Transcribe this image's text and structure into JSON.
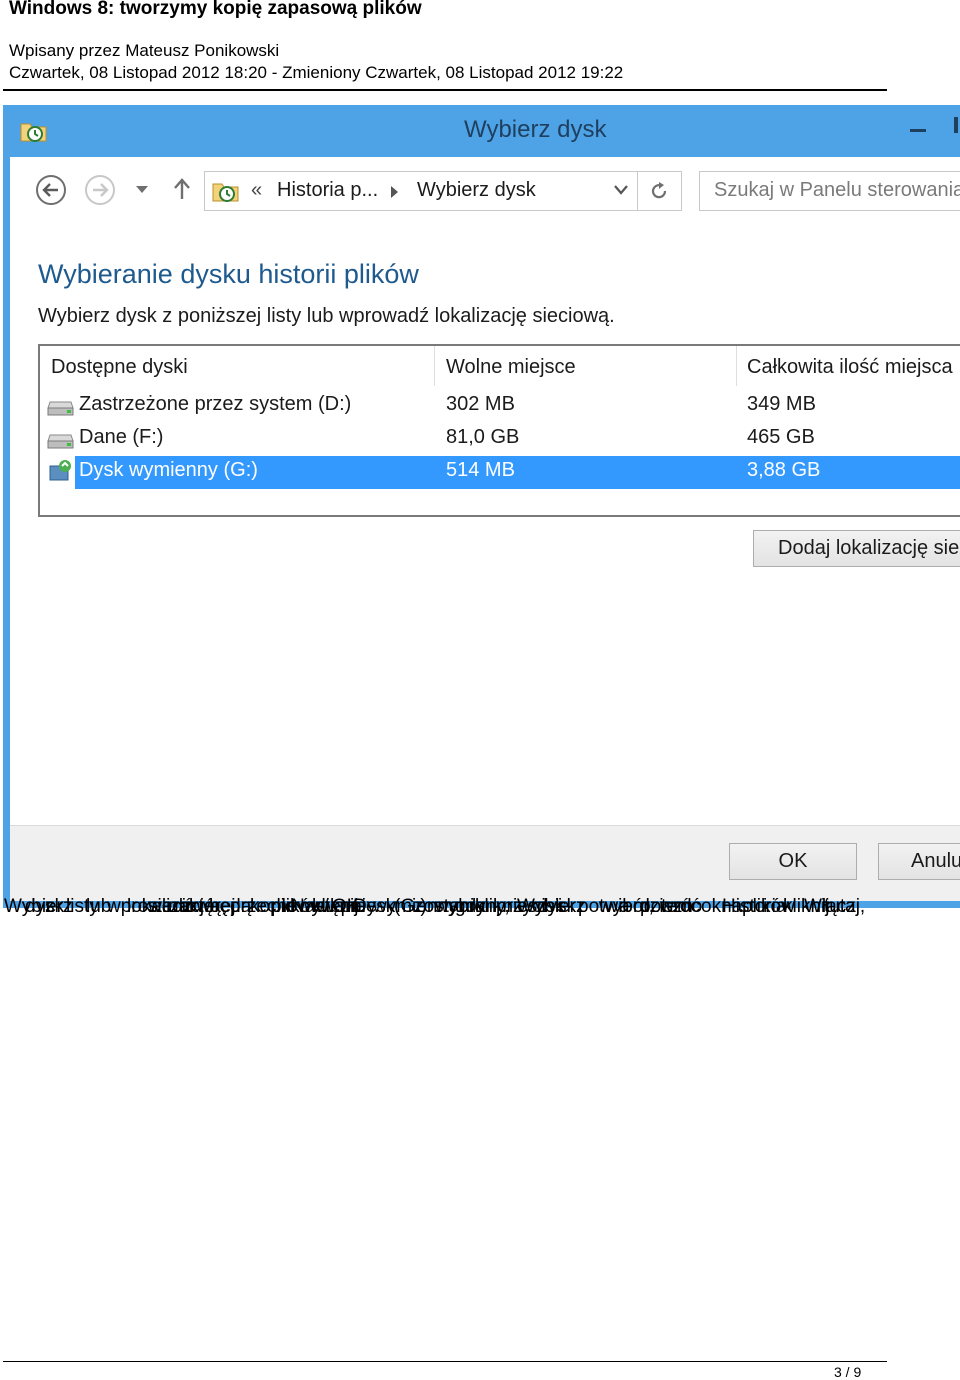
{
  "document": {
    "title": "Windows 8: tworzymy kopię zapasową plików",
    "author_line": "Wpisany przez Mateusz Ponikowski",
    "date_line": "Czwartek, 08 Listopad 2012 18:20 - Zmieniony Czwartek, 08 Listopad 2012 19:22",
    "page_number": "3 / 9"
  },
  "window": {
    "title": "Wybierz dysk",
    "accent_color": "#4ea3e6",
    "icon": "file-history-icon"
  },
  "address_bar": {
    "separator": "«",
    "breadcrumbs": [
      "Historia p...",
      "Wybierz dysk"
    ],
    "search_placeholder": "Szukaj w Panelu sterowania"
  },
  "content": {
    "heading": "Wybieranie dysku historii plików",
    "instruction": "Wybierz dysk z poniższej listy lub wprowadź lokalizację sieciową."
  },
  "drive_list": {
    "columns": [
      "Dostępne dyski",
      "Wolne miejsce",
      "Całkowita ilość miejsca"
    ],
    "rows": [
      {
        "name": "Zastrzeżone przez system (D:)",
        "free": "302 MB",
        "total": "349 MB",
        "icon": "hard-drive-icon",
        "selected": false
      },
      {
        "name": "Dane (F:)",
        "free": "81,0 GB",
        "total": "465 GB",
        "icon": "hard-drive-icon",
        "selected": false
      },
      {
        "name": "Dysk wymienny (G:)",
        "free": "514 MB",
        "total": "3,88 GB",
        "icon": "removable-drive-icon",
        "selected": true
      }
    ],
    "selection_color": "#3399ff"
  },
  "buttons": {
    "add_location": "Dodaj lokalizację sie",
    "ok": "OK",
    "cancel": "Anulu"
  },
  "overlapping_text": [
    "Wybierz",
    "dysk",
    "z",
    "listy",
    "lub",
    "wprowadź",
    "lokalizację",
    "sieciową,",
    "na",
    "której",
    "będą",
    "przechowywane",
    "kopie",
    "plików.",
    "Następnie",
    "kliknij",
    "OK.",
    "Dysk",
    "wymienny",
    "(G:)",
    "zostanie",
    "wybrany,",
    "gdy",
    "klikniesz",
    "przycisk",
    "Wybierz",
    "dysk",
    "i",
    "potwierdzisz",
    "wybór,",
    "a",
    "potem",
    "wróć",
    "do",
    "okna",
    "Historia",
    "plików",
    "i",
    "kliknij",
    "Włącz",
    "tutaj,"
  ]
}
